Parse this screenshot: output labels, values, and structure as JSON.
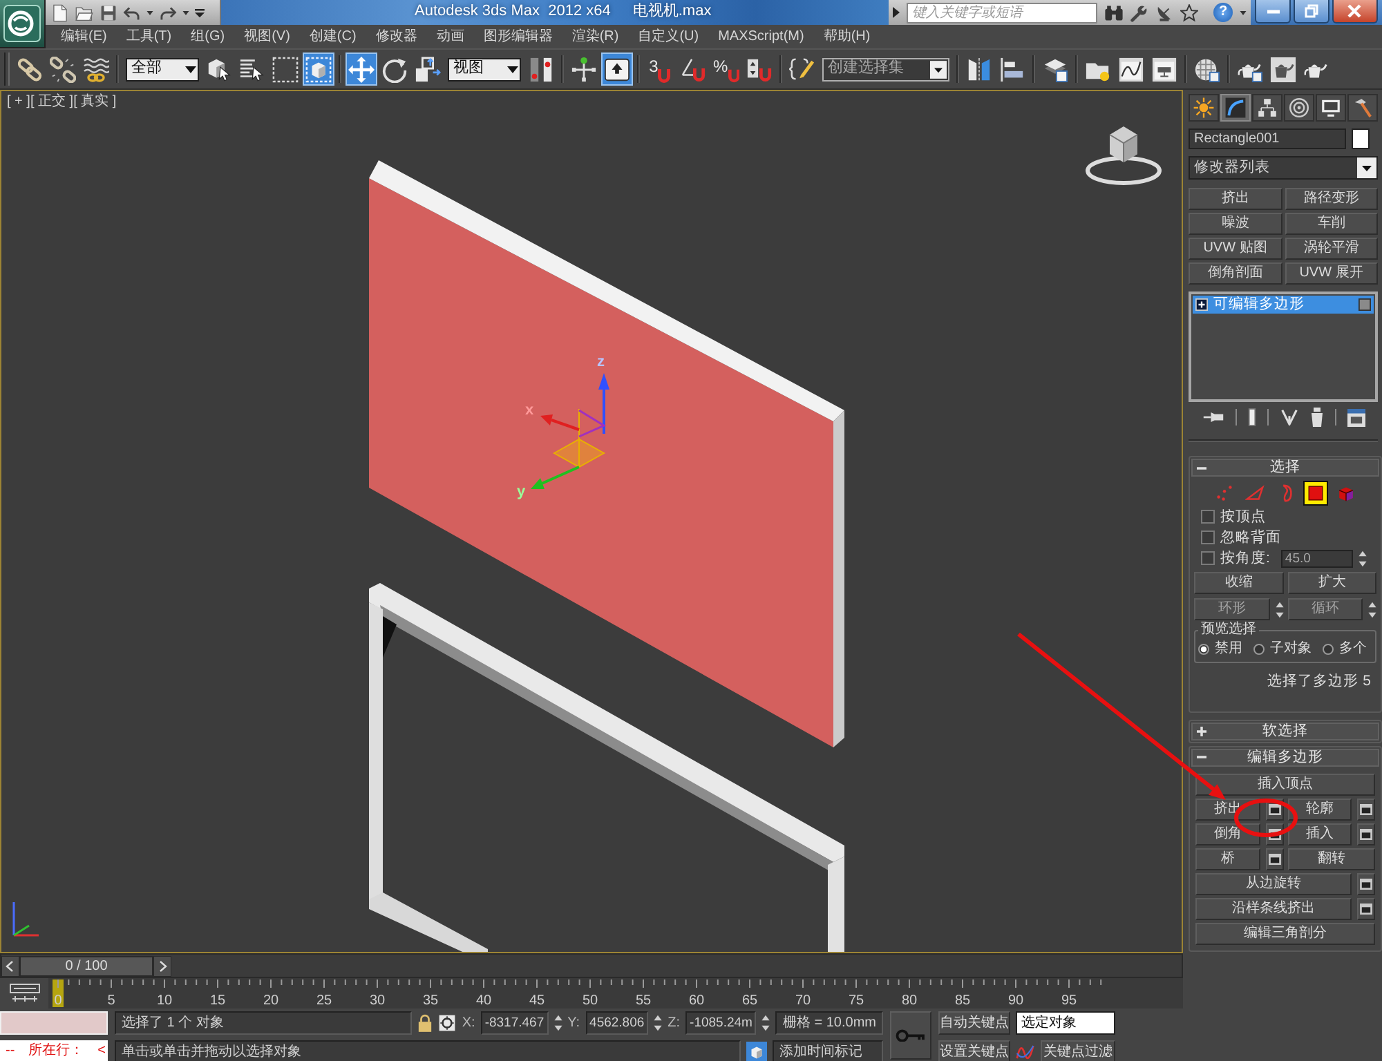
{
  "title_bar": {
    "title": "Autodesk 3ds Max  2012 x64",
    "file_name": "电视机.max",
    "search": {
      "placeholder": "键入关键字或短语"
    },
    "help_glyph": "?"
  },
  "menu_bar": [
    "编辑(E)",
    "工具(T)",
    "组(G)",
    "视图(V)",
    "创建(C)",
    "修改器",
    "动画",
    "图形编辑器",
    "渲染(R)",
    "自定义(U)",
    "MAXScript(M)",
    "帮助(H)"
  ],
  "main_toolbar": {
    "groups": [
      [
        {
          "kind": "link",
          "selected": false
        },
        {
          "kind": "unlink",
          "selected": false
        },
        {
          "kind": "bind",
          "selected": false
        }
      ],
      [
        {
          "kind": "dropdown",
          "value": "全部",
          "editable": false
        },
        {
          "kind": "select",
          "selected": false
        },
        {
          "kind": "select_by_name",
          "selected": false
        },
        {
          "kind": "region",
          "selected": false
        },
        {
          "kind": "window_crossing",
          "selected": true
        }
      ],
      [
        {
          "kind": "move",
          "selected": true
        },
        {
          "kind": "rotate",
          "selected": false
        },
        {
          "kind": "scale",
          "selected": false
        },
        {
          "kind": "dropdown",
          "value": "视图",
          "editable": false
        },
        {
          "kind": "pivot",
          "selected": false
        }
      ],
      [
        {
          "kind": "manipulate",
          "selected": false
        },
        {
          "kind": "shortcut",
          "selected": true
        }
      ],
      [
        {
          "kind": "snap",
          "glyph": "3",
          "selected": false
        },
        {
          "kind": "angle_snap",
          "selected": false
        },
        {
          "kind": "percent_snap",
          "glyph": "%",
          "selected": false
        },
        {
          "kind": "spinner_snap",
          "selected": false
        }
      ],
      [
        {
          "kind": "named_sets",
          "selected": false
        },
        {
          "kind": "dropdown",
          "value": "创建选择集",
          "editable": true
        }
      ],
      [
        {
          "kind": "mirror",
          "selected": false
        },
        {
          "kind": "align",
          "selected": false
        }
      ],
      [
        {
          "kind": "layers",
          "selected": false
        }
      ],
      [
        {
          "kind": "graphite",
          "selected": false
        },
        {
          "kind": "curve_editor",
          "selected": false
        },
        {
          "kind": "schematic",
          "selected": false
        }
      ],
      [
        {
          "kind": "material",
          "selected": false
        }
      ],
      [
        {
          "kind": "render_setup",
          "selected": false
        },
        {
          "kind": "render_frame",
          "selected": false
        },
        {
          "kind": "render",
          "selected": false
        }
      ]
    ]
  },
  "viewport": {
    "labels": [
      "[ + ]",
      "[ 正交 ]",
      "[ 真实 ]"
    ],
    "gizmo_axes": [
      "x",
      "y",
      "z"
    ]
  },
  "command_panel": {
    "tabs": [
      {
        "kind": "create",
        "selected": false
      },
      {
        "kind": "modify",
        "selected": true
      },
      {
        "kind": "hierarchy",
        "selected": false
      },
      {
        "kind": "motion",
        "selected": false
      },
      {
        "kind": "display",
        "selected": false
      },
      {
        "kind": "utilities",
        "selected": false
      }
    ],
    "object_name": "Rectangle001",
    "modifier_list": "修改器列表",
    "modifier_buttons": [
      "挤出",
      "路径变形",
      "噪波",
      "车削",
      "UVW 贴图",
      "涡轮平滑",
      "倒角剖面",
      "UVW 展开"
    ],
    "stack": [
      {
        "label": "可编辑多边形",
        "selected": true
      }
    ],
    "selection_rollout": {
      "title": "选择",
      "expanded": true,
      "levels": [
        {
          "kind": "vertex",
          "selected": false
        },
        {
          "kind": "edge",
          "selected": false
        },
        {
          "kind": "border",
          "selected": false
        },
        {
          "kind": "polygon",
          "selected": true
        },
        {
          "kind": "element",
          "selected": false
        }
      ],
      "options": [
        {
          "label": "按顶点",
          "checked": false
        },
        {
          "label": "忽略背面",
          "checked": false
        },
        {
          "label": "按角度:",
          "checked": false,
          "angle": {
            "value": "45.0",
            "disabled": true
          }
        }
      ],
      "buttons": [
        {
          "label": "收缩",
          "disabled": false,
          "spinner": false
        },
        {
          "label": "扩大",
          "disabled": false,
          "spinner": false
        },
        {
          "label": "环形",
          "disabled": true,
          "spinner": true
        },
        {
          "label": "循环",
          "disabled": true,
          "spinner": true
        }
      ],
      "preview": {
        "title": "预览选择",
        "options": [
          {
            "label": "禁用",
            "selected": true
          },
          {
            "label": "子对象",
            "selected": false
          },
          {
            "label": "多个",
            "selected": false
          }
        ]
      },
      "info": "选择了多边形 5"
    },
    "soft_selection_rollout": {
      "title": "软选择",
      "expanded": false
    },
    "edit_polygons_rollout": {
      "title": "编辑多边形",
      "expanded": true,
      "rows": [
        [
          {
            "label": "插入顶点",
            "settings": false
          }
        ],
        [
          {
            "label": "挤出",
            "settings": true
          },
          {
            "label": "轮廓",
            "settings": true
          }
        ],
        [
          {
            "label": "倒角",
            "settings": true
          },
          {
            "label": "插入",
            "settings": true
          }
        ],
        [
          {
            "label": "桥",
            "settings": true
          },
          {
            "label": "翻转",
            "settings": false
          }
        ],
        [
          {
            "label": "从边旋转",
            "settings": true
          }
        ],
        [
          {
            "label": "沿样条线挤出",
            "settings": true
          }
        ],
        [
          {
            "label": "编辑三角剖分",
            "settings": false
          }
        ]
      ]
    }
  },
  "timeline": {
    "slider": {
      "text": "0 / 100",
      "level": 0
    },
    "frame_labels": [
      "0",
      "5",
      "10",
      "15",
      "20",
      "25",
      "30",
      "35",
      "40",
      "45",
      "50",
      "55",
      "60",
      "65",
      "70",
      "75",
      "80",
      "85",
      "90",
      "95"
    ]
  },
  "status_bar": {
    "listener": [
      "--",
      "所在行：",
      "<"
    ],
    "prompt": "选择了 1 个 对象",
    "hint": "单击或单击并拖动以选择对象",
    "coords": [
      {
        "label": "X:",
        "value": "-8317.467"
      },
      {
        "label": "Y:",
        "value": "4562.806"
      },
      {
        "label": "Z:",
        "value": "-1085.24m"
      }
    ],
    "grid": "栅格 = 10.0mm",
    "time_tag": "添加时间标记",
    "auto_key": "自动关键点",
    "key_mode": "选定对象",
    "set_key": "设置关键点",
    "key_filters": "关键点过滤"
  },
  "annotations": {
    "arrow": true,
    "circle": true
  }
}
